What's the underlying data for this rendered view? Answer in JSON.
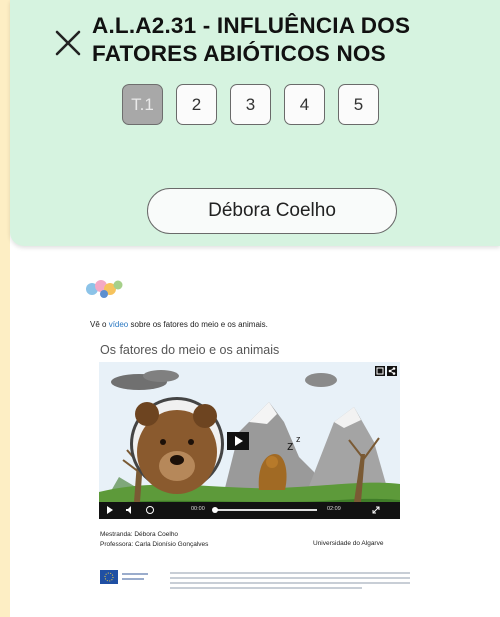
{
  "header": {
    "title": "A.L.A2.31 - INFLUÊNCIA DOS FATORES ABIÓTICOS NOS",
    "close_icon": "close-icon",
    "tabs": [
      "T.1",
      "2",
      "3",
      "4",
      "5"
    ],
    "active_tab": "T.1",
    "user_name": "Débora Coelho"
  },
  "document": {
    "intro_prefix": "Vê o ",
    "intro_link": "vídeo",
    "intro_suffix": " sobre os fatores do meio e os animais.",
    "video_title": "Os fatores do meio e os animais",
    "video": {
      "current_time": "00:00",
      "duration": "02:09",
      "icons": [
        "play-icon",
        "volume-icon",
        "speed-icon",
        "fullscreen-icon",
        "share-icon",
        "watch-later-icon"
      ]
    },
    "credits": {
      "student": "Mestranda: Débora Coelho",
      "teacher": "Professora: Carla Dionísio Gonçalves",
      "university": "Universidade do Algarve"
    }
  },
  "colors": {
    "header_bg": "#d6f3e0",
    "left_strip": "#fdeec4",
    "active_tab_bg": "#a8a8a8",
    "link": "#2a78c2"
  }
}
